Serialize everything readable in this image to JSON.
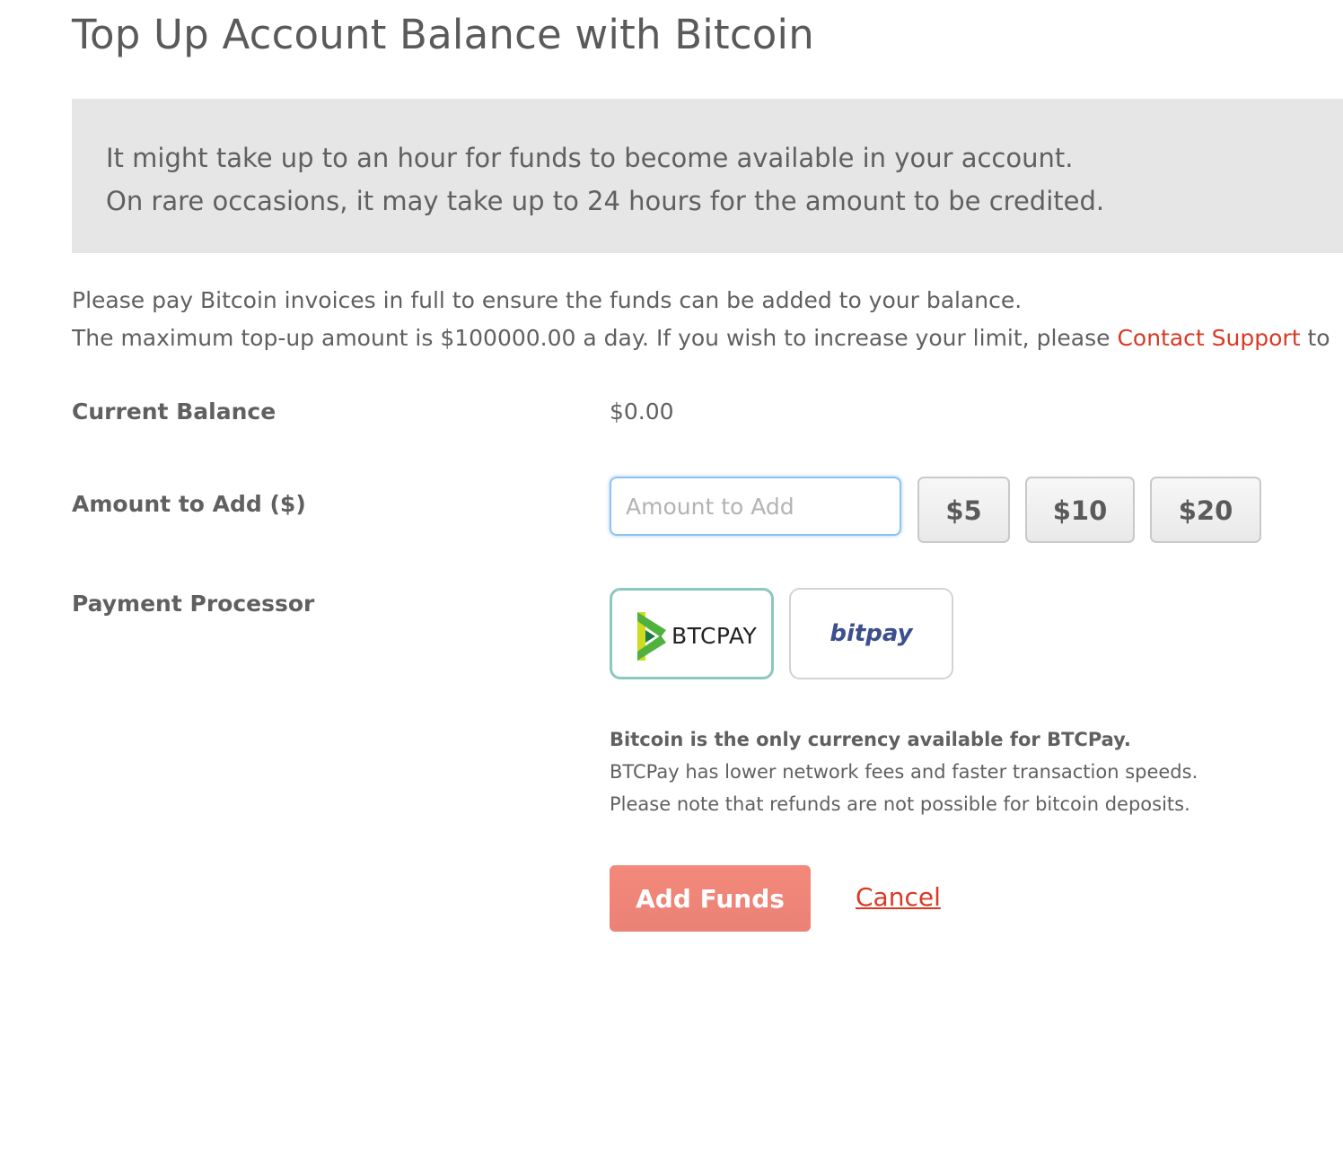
{
  "page": {
    "title": "Top Up Account Balance with Bitcoin"
  },
  "notice": {
    "line1": "It might take up to an hour for funds to become available in your account.",
    "line2": "On rare occasions, it may take up to 24 hours for the amount to be credited."
  },
  "info": {
    "line1": "Please pay Bitcoin invoices in full to ensure the funds can be added to your balance.",
    "line2_prefix": "The maximum top-up amount is $100000.00 a day. If you wish to increase your limit, please ",
    "contact_link": "Contact Support",
    "line2_suffix": " to"
  },
  "balance": {
    "label": "Current Balance",
    "value": "$0.00"
  },
  "amount": {
    "label": "Amount to Add ($)",
    "placeholder": "Amount to Add",
    "value": "",
    "presets": [
      "$5",
      "$10",
      "$20"
    ]
  },
  "processor": {
    "label": "Payment Processor",
    "options": [
      {
        "name": "BTCPAY",
        "selected": true
      },
      {
        "name": "bitpay",
        "selected": false
      }
    ],
    "note_strong": "Bitcoin is the only currency available for BTCPay.",
    "note_line2": "BTCPay has lower network fees and faster transaction speeds.",
    "note_line3": "Please note that refunds are not possible for bitcoin deposits."
  },
  "actions": {
    "submit_label": "Add Funds",
    "cancel_label": "Cancel"
  },
  "colors": {
    "accent_red": "#d83a24",
    "submit_bg": "#f3897b",
    "selected_border": "#8cc7c0",
    "notice_bg": "#e6e6e6"
  },
  "icons": {
    "btcpay_logo": "btcpay-logo-icon"
  }
}
